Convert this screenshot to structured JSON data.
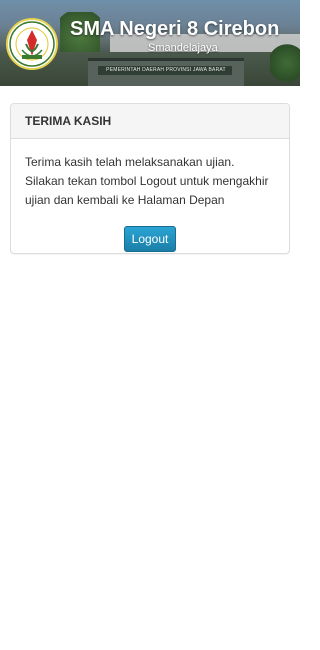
{
  "header": {
    "title": "SMA Negeri 8 Cirebon",
    "subtitle": "Smandelajaya",
    "background_sign_text": "PEMERINTAH DAERAH PROVINSI JAWA BARAT",
    "logo_icon": "school-emblem-icon",
    "logo_text": "SMA NEGERI 8 CIREBON"
  },
  "panel": {
    "title": "TERIMA KASIH",
    "message": "Terima kasih telah melaksanakan ujian. Silakan tekan tombol Logout untuk mengakhir ujian dan kembali ke Halaman Depan",
    "logout_label": "Logout"
  },
  "colors": {
    "button": "#2a9ac8",
    "logo_ring": "#e6d24e",
    "panel_heading_bg": "#f5f5f5"
  }
}
